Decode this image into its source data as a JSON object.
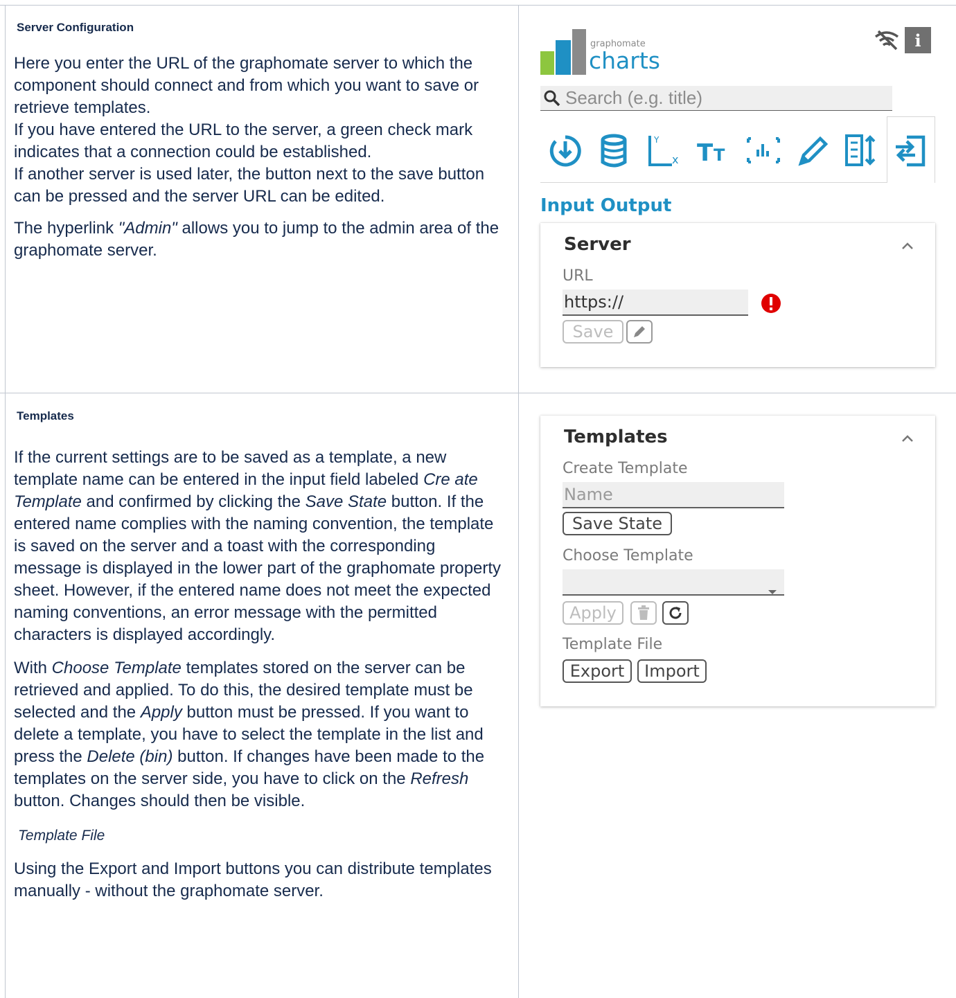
{
  "doc": {
    "server_section": {
      "title": "Server Configuration",
      "para1": "Here you enter the URL of the graphomate server to which the component should connect and from which you want to save or retrieve templates.",
      "para2": "If you have entered the URL to the server, a green check mark indicates that a connection could be established.",
      "para3": "If another server is used later, the button next to the save button can be pressed and the server URL can be edited.",
      "para4_prefix": "The hyperlink ",
      "para4_em": "\"Admin\"",
      "para4_suffix": " allows you to jump to the admin area of the graphomate server."
    },
    "templates_section": {
      "title": "Templates",
      "p1_a": "If the current settings are to be saved as a template, a new template name can be entered in the input field labeled ",
      "p1_em1": "Cre ate Template",
      "p1_b": " and confirmed by clicking the ",
      "p1_em2": "Save State",
      "p1_c": " button. If the entered name complies with the naming convention, the template is saved on the server and a toast with the corresponding message is displayed in the lower part of the graphomate property sheet. However, if the entered name does not meet the expected naming conventions, an error message with the permitted characters is displayed accordingly.",
      "p2_em1": "Choose Template",
      "p2_a": " templates stored on the server can be retrieved and applied. To do this, the desired template must be selected and the ",
      "p2_em2": "Apply",
      "p2_b": " button must be pressed. If you want to delete a template, you have to select the template in the list and press the ",
      "p2_em3": "Delete (bin)",
      "p2_c": " button. If changes have been made to the templates on the server side, you have to click on the ",
      "p2_em4": "Refresh",
      "p2_d": " button. Changes should then be visible.",
      "p2_lead": "With ",
      "sub_heading": "Template File",
      "p3": "Using the Export and Import buttons you can distribute templates manually - without the graphomate server."
    }
  },
  "panel": {
    "logo_small": "graphomate",
    "logo_big": "charts",
    "search_placeholder": "Search (e.g. title)",
    "section_heading": "Input Output",
    "server_card": {
      "title": "Server",
      "url_label": "URL",
      "url_value": "https://",
      "save_label": "Save"
    },
    "templates_card": {
      "title": "Templates",
      "create_label": "Create Template",
      "name_placeholder": "Name",
      "save_state_label": "Save State",
      "choose_label": "Choose Template",
      "apply_label": "Apply",
      "file_label": "Template File",
      "export_label": "Export",
      "import_label": "Import"
    },
    "colors": {
      "accent": "#1f90c4",
      "logo_green": "#8dc63f",
      "logo_blue": "#1f90c4",
      "logo_gray": "#8a8a8a",
      "error": "#e00000"
    }
  }
}
